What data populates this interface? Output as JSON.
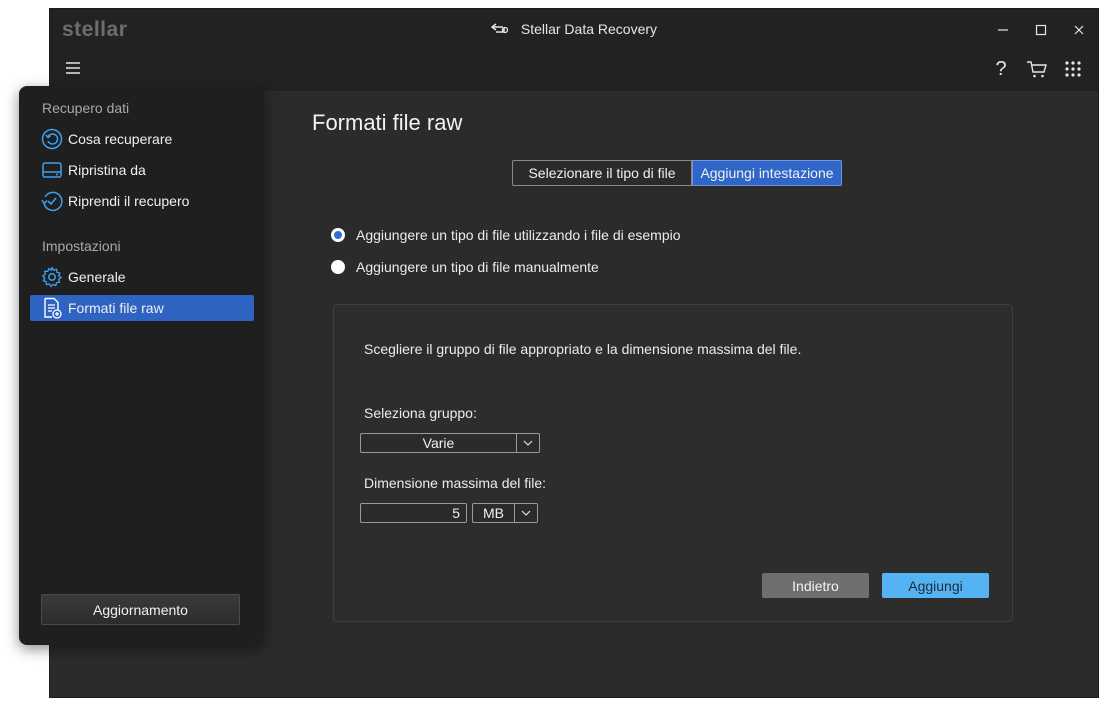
{
  "app": {
    "logo_text": "stellar",
    "window_title": "Stellar Data Recovery",
    "controls": {
      "minimize": "—",
      "maximize": "☐",
      "close": "✕"
    }
  },
  "toolbar": {
    "help_label": "?"
  },
  "sidebar": {
    "section_recovery": "Recupero dati",
    "section_settings": "Impostazioni",
    "items": [
      {
        "label": "Cosa recuperare",
        "icon": "restore-circle-icon"
      },
      {
        "label": "Ripristina da",
        "icon": "drive-icon"
      },
      {
        "label": "Riprendi il recupero",
        "icon": "resume-check-icon"
      },
      {
        "label": "Generale",
        "icon": "gear-icon"
      },
      {
        "label": "Formati file raw",
        "icon": "file-add-icon",
        "active": true
      }
    ],
    "update_button": "Aggiornamento"
  },
  "main": {
    "title": "Formati file raw",
    "tabs": [
      {
        "label": "Selezionare il tipo di file",
        "active": false
      },
      {
        "label": "Aggiungi intestazione",
        "active": true
      }
    ],
    "radio_options": [
      {
        "label": "Aggiungere un tipo di file utilizzando i file di esempio",
        "checked": true
      },
      {
        "label": "Aggiungere un tipo di file manualmente",
        "checked": false
      }
    ],
    "panel": {
      "instruction": "Scegliere il gruppo di file appropriato e la dimensione massima del file.",
      "group_label": "Seleziona gruppo:",
      "group_value": "Varie",
      "size_label": "Dimensione massima del file:",
      "size_value": "5",
      "unit_value": "MB",
      "back_button": "Indietro",
      "add_button": "Aggiungi"
    }
  },
  "colors": {
    "accent": "#2f63c2",
    "add_button": "#55b3f3",
    "background": "#2b2b2b",
    "sidebar": "#1f1f1f"
  }
}
